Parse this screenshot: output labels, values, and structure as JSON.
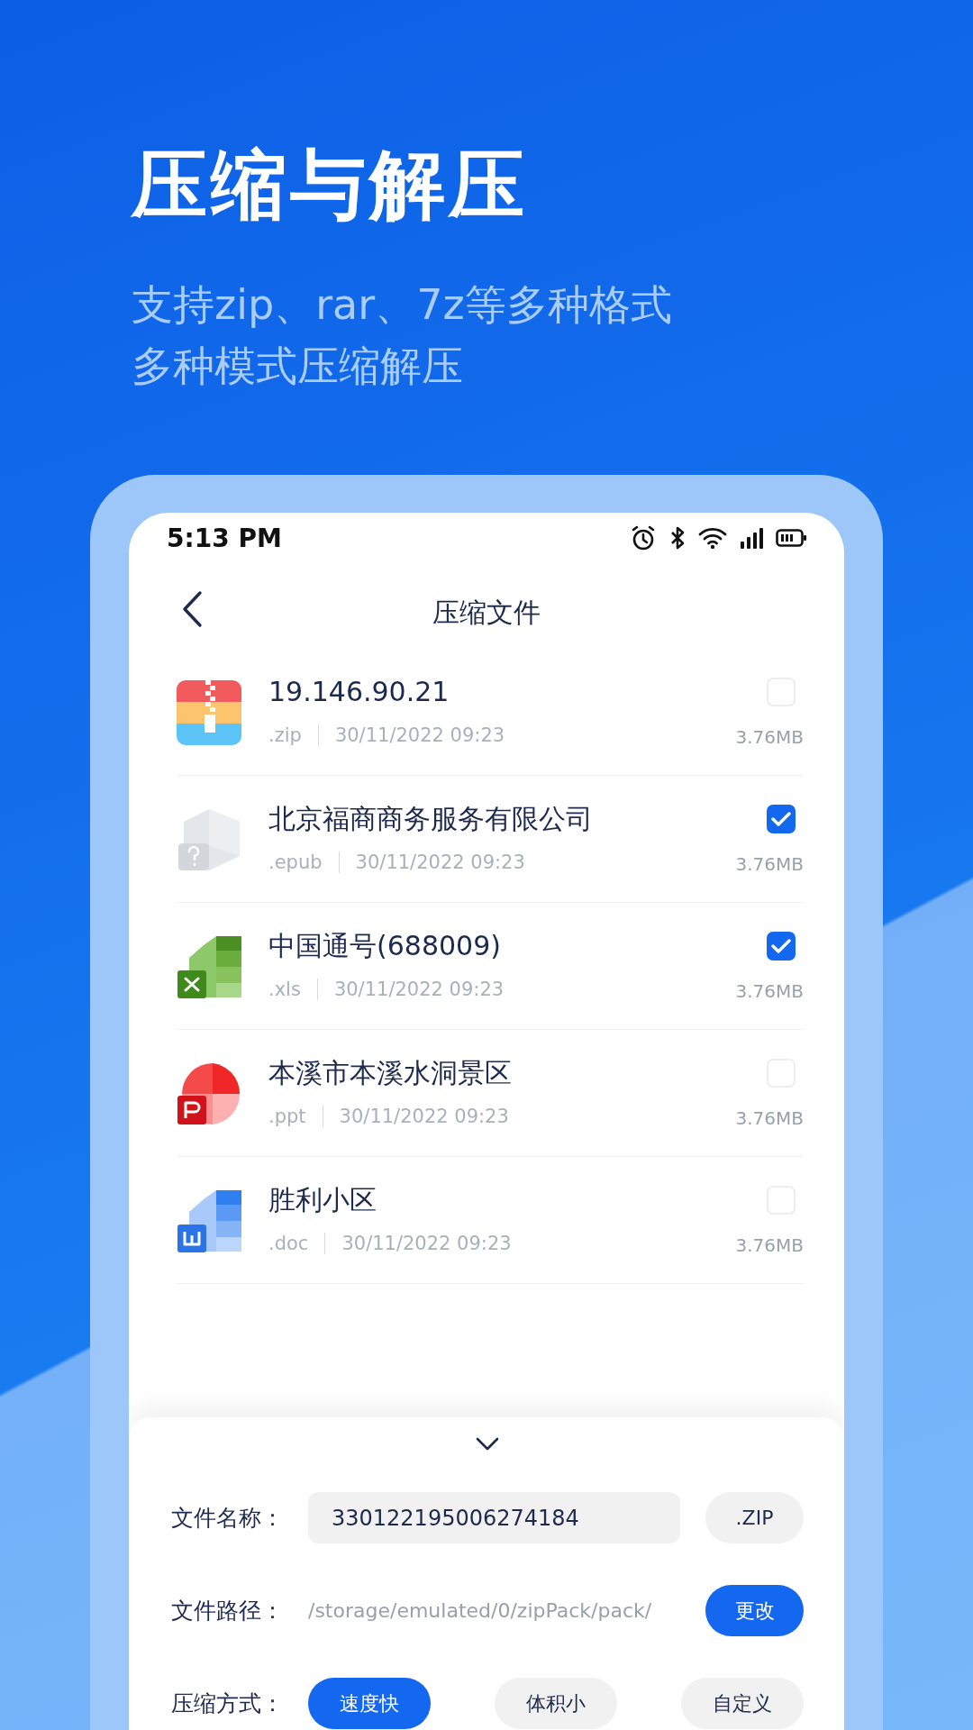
{
  "headline": {
    "title": "压缩与解压",
    "subtitle_lines": [
      "支持zip、rar、7z等多种格式",
      "多种模式压缩解压"
    ]
  },
  "status_bar": {
    "time": "5:13 PM"
  },
  "nav": {
    "title": "压缩文件"
  },
  "files": [
    {
      "kind": "zip",
      "name": "19.146.90.21",
      "ext": ".zip",
      "date": "30/11/2022  09:23",
      "size": "3.76MB",
      "checked": false
    },
    {
      "kind": "epub",
      "name": "北京福商商务服务有限公司",
      "ext": ".epub",
      "date": "30/11/2022  09:23",
      "size": "3.76MB",
      "checked": true
    },
    {
      "kind": "xls",
      "name": "中国通号(688009)",
      "ext": ".xls",
      "date": "30/11/2022  09:23",
      "size": "3.76MB",
      "checked": true
    },
    {
      "kind": "ppt",
      "name": "本溪市本溪水洞景区",
      "ext": ".ppt",
      "date": "30/11/2022  09:23",
      "size": "3.76MB",
      "checked": false
    },
    {
      "kind": "doc",
      "name": "胜利小区",
      "ext": ".doc",
      "date": "30/11/2022  09:23",
      "size": "3.76MB",
      "checked": false
    }
  ],
  "sheet": {
    "file_name": {
      "label": "文件名称：",
      "value": "330122195006274184",
      "button": ".ZIP"
    },
    "file_path": {
      "label": "文件路径：",
      "value": "/storage/emulated/0/zipPack/pack/",
      "button": "更改"
    },
    "compress_mode": {
      "label": "压缩方式：",
      "options": [
        {
          "label": "速度快",
          "selected": true
        },
        {
          "label": "体积小",
          "selected": false
        },
        {
          "label": "自定义",
          "selected": false
        }
      ]
    }
  }
}
